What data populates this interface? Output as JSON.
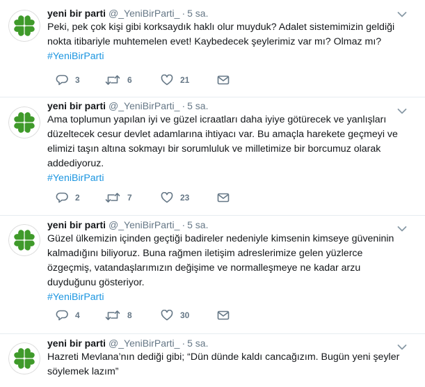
{
  "tweets": [
    {
      "name": "yeni bir parti",
      "handle": "@_YeniBirParti_",
      "dot": "·",
      "time": "5 sa.",
      "lines": [
        "Peki, pek çok kişi gibi korksaydık haklı olur muyduk? Adalet sistemimizin geldiği",
        "nokta itibariyle muhtemelen evet! Kaybedecek şeylerimiz var mı? Olmaz mı?"
      ],
      "hashtag": "#YeniBirParti",
      "replies": "3",
      "retweets": "6",
      "likes": "21"
    },
    {
      "name": "yeni bir parti",
      "handle": "@_YeniBirParti_",
      "dot": "·",
      "time": "5 sa.",
      "lines": [
        "Ama toplumun yapılan iyi ve güzel icraatları daha iyiye götürecek ve yanlışları",
        "düzeltecek cesur devlet adamlarına ihtiyacı var. Bu amaçla harekete geçmeyi ve",
        "elimizi taşın altına sokmayı bir sorumluluk ve milletimize bir borcumuz olarak",
        "addediyoruz."
      ],
      "hashtag": "#YeniBirParti",
      "replies": "2",
      "retweets": "7",
      "likes": "23"
    },
    {
      "name": "yeni bir parti",
      "handle": "@_YeniBirParti_",
      "dot": "·",
      "time": "5 sa.",
      "lines": [
        "Güzel ülkemizin içinden geçtiği badireler nedeniyle kimsenin kimseye güveninin",
        "kalmadığını biliyoruz. Buna rağmen iletişim adreslerimize gelen yüzlerce",
        "özgeçmiş, vatandaşlarımızın değişime ve normalleşmeye ne kadar arzu",
        "duyduğunu gösteriyor."
      ],
      "hashtag": "#YeniBirParti",
      "replies": "4",
      "retweets": "8",
      "likes": "30"
    },
    {
      "name": "yeni bir parti",
      "handle": "@_YeniBirParti_",
      "dot": "·",
      "time": "5 sa.",
      "lines": [
        "Hazreti Mevlana’nın dediği gibi; “Dün dünde kaldı cancağızım. Bugün yeni şeyler",
        "söylemek lazım”"
      ]
    }
  ],
  "icons": {
    "avatar": "four-leaf-clover-icon",
    "menu": "chevron-down-icon",
    "reply": "reply-icon",
    "retweet": "retweet-icon",
    "like": "heart-icon",
    "dm": "envelope-icon"
  },
  "colors": {
    "clover_green": "#3f9a2a",
    "hashtag": "#1b95e0",
    "muted": "#657786"
  }
}
